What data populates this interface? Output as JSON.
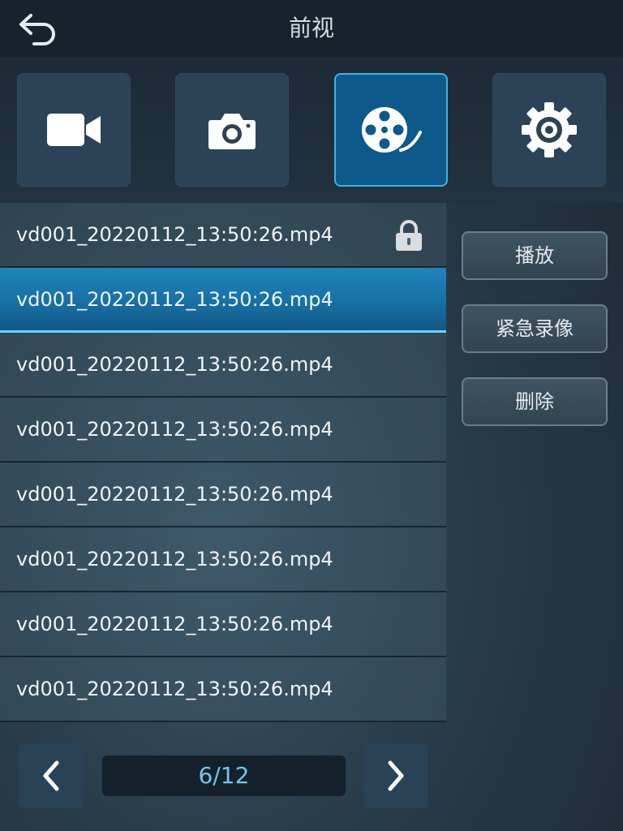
{
  "header": {
    "title": "前视",
    "back_icon": "back-arrow-icon"
  },
  "modes": [
    {
      "name": "video-record",
      "icon": "video-camera-icon",
      "active": false
    },
    {
      "name": "photo",
      "icon": "camera-icon",
      "active": false
    },
    {
      "name": "playback",
      "icon": "film-reel-icon",
      "active": true
    },
    {
      "name": "settings",
      "icon": "gear-icon",
      "active": false
    }
  ],
  "files": [
    {
      "name": "vd001_20220112_13:50:26.mp4",
      "locked": true,
      "selected": false
    },
    {
      "name": "vd001_20220112_13:50:26.mp4",
      "locked": false,
      "selected": true
    },
    {
      "name": "vd001_20220112_13:50:26.mp4",
      "locked": false,
      "selected": false
    },
    {
      "name": "vd001_20220112_13:50:26.mp4",
      "locked": false,
      "selected": false
    },
    {
      "name": "vd001_20220112_13:50:26.mp4",
      "locked": false,
      "selected": false
    },
    {
      "name": "vd001_20220112_13:50:26.mp4",
      "locked": false,
      "selected": false
    },
    {
      "name": "vd001_20220112_13:50:26.mp4",
      "locked": false,
      "selected": false
    },
    {
      "name": "vd001_20220112_13:50:26.mp4",
      "locked": false,
      "selected": false
    }
  ],
  "actions": {
    "play_label": "播放",
    "emergency_label": "紧急录像",
    "delete_label": "删除"
  },
  "pagination": {
    "indicator": "6/12",
    "prev_icon": "chevron-left-icon",
    "next_icon": "chevron-right-icon"
  },
  "colors": {
    "accent": "#3fb2e6",
    "selected_row": "#1870a4",
    "page_text": "#6ec7f3"
  }
}
